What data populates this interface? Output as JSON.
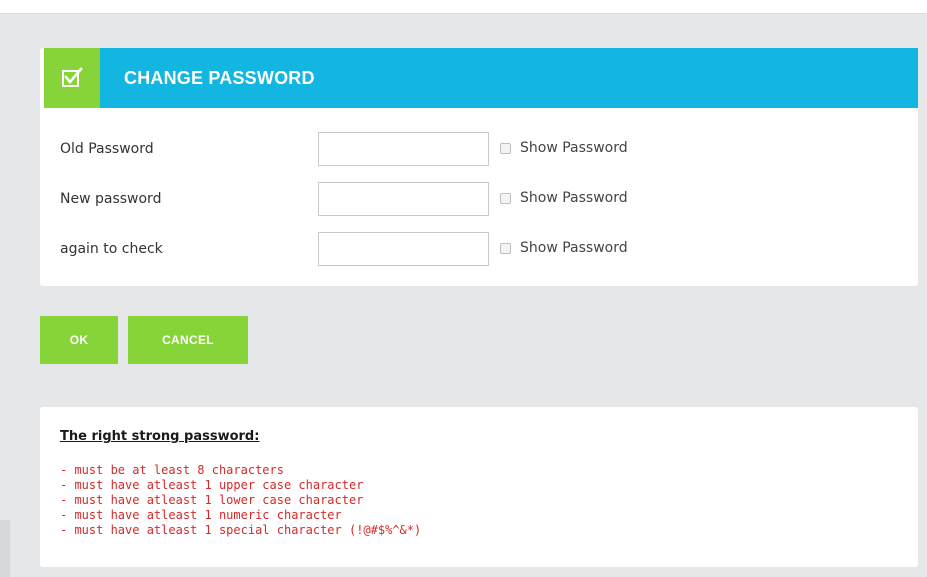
{
  "header": {
    "title": "CHANGE PASSWORD",
    "icon": "checkbox-checked-icon",
    "accent_color": "#13b5e1",
    "icon_bg_color": "#86d33a"
  },
  "form": {
    "old_password": {
      "label": "Old Password",
      "value": "",
      "show_label": "Show Password",
      "show_checked": false
    },
    "new_password": {
      "label": "New password",
      "value": "",
      "show_label": "Show Password",
      "show_checked": false
    },
    "again_password": {
      "label": "again to check",
      "value": "",
      "show_label": "Show Password",
      "show_checked": false
    }
  },
  "buttons": {
    "ok_label": "OK",
    "cancel_label": "CANCEL",
    "color": "#86d33a"
  },
  "rules": {
    "title": "The right strong password:",
    "items": [
      "- must be at least 8 characters",
      "- must have atleast 1 upper case character",
      "- must have atleast 1 lower case character",
      "- must have atleast 1 numeric character",
      "- must have atleast 1 special character (!@#$%^&*)"
    ],
    "color": "#d42a2a"
  }
}
